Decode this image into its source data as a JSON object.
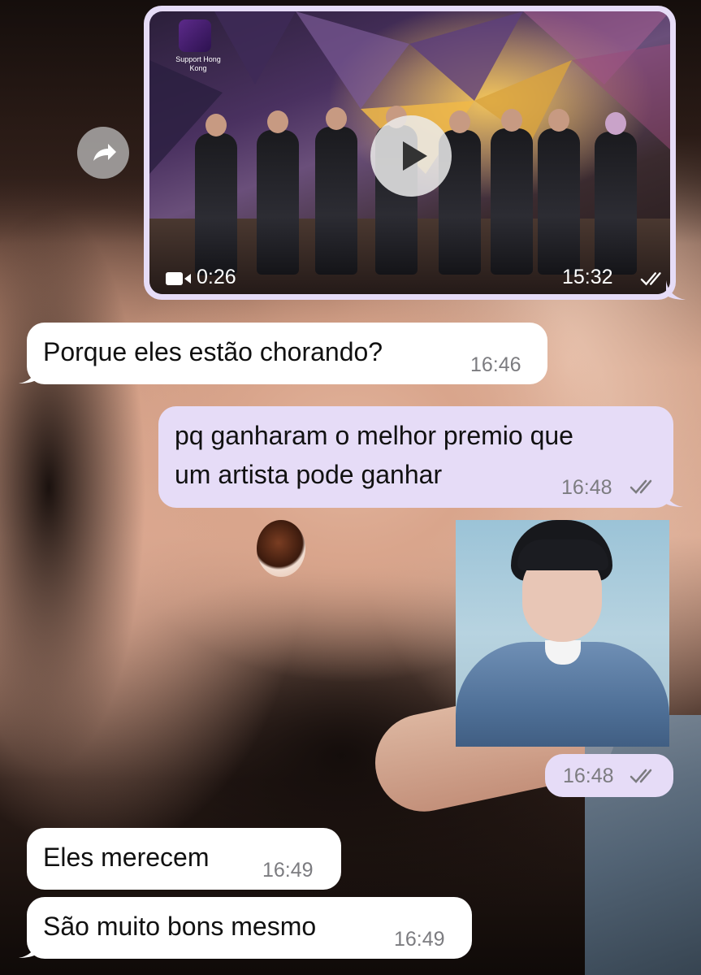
{
  "chat": {
    "video_message": {
      "duration": "0:26",
      "time": "15:32",
      "thumbnail_logo_text": "Support Hong Kong"
    },
    "messages": [
      {
        "direction": "incoming",
        "text": "Porque eles estão chorando?",
        "time": "16:46"
      },
      {
        "direction": "outgoing",
        "text_line1": "pq ganharam o melhor premio que",
        "text_line2": "um artista pode ganhar",
        "time": "16:48"
      },
      {
        "direction": "outgoing",
        "type": "photo",
        "time": "16:48"
      },
      {
        "direction": "incoming",
        "text": "Eles merecem",
        "time": "16:49"
      },
      {
        "direction": "incoming",
        "text": "São muito bons mesmo",
        "time": "16:49"
      }
    ]
  },
  "colors": {
    "outgoing_bubble": "#e6dcf7",
    "incoming_bubble": "#ffffff",
    "timestamp": "#7c7c80"
  }
}
